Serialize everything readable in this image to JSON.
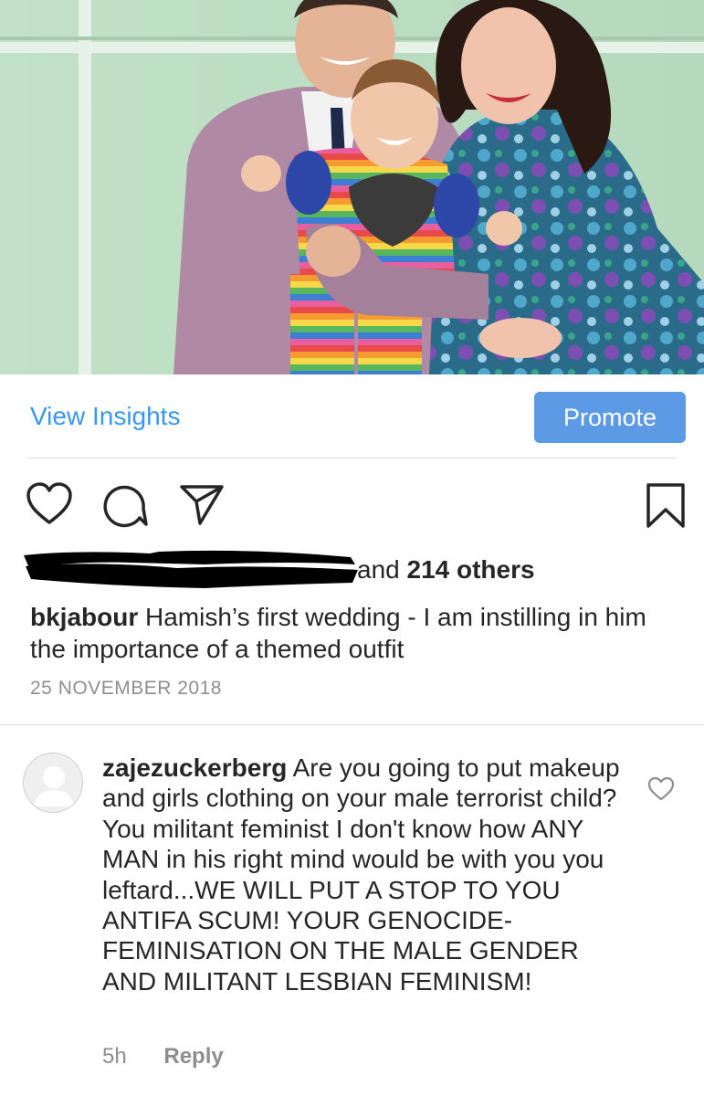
{
  "post": {
    "photo_alt": "family-photo",
    "view_insights_label": "View Insights",
    "promote_label": "Promote",
    "likes": {
      "others_prefix": "and",
      "others_count": "214 others"
    },
    "caption": {
      "username": "bkjabour",
      "text": "Hamish’s first wedding - I am instilling in him the importance of a themed outfit"
    },
    "date": "25 NOVEMBER 2018"
  },
  "comment": {
    "username": "zajezuckerberg",
    "text": "Are you going to put makeup and girls clothing on your male terrorist child? You militant feminist I don't know how ANY MAN in his right mind would be with you you leftard...WE WILL PUT A STOP TO YOU ANTIFA SCUM! YOUR GENOCIDE-FEMINISATION ON THE MALE GENDER AND MILITANT LESBIAN FEMINISM!",
    "time": "5h",
    "reply_label": "Reply"
  },
  "icons": {
    "like": "heart-icon",
    "comment": "comment-icon",
    "share": "paper-plane-icon",
    "save": "bookmark-icon",
    "comment_like": "heart-icon",
    "avatar": "default-avatar-icon"
  },
  "colors": {
    "link_blue": "#3897f0",
    "promote_bg": "#5c9ae6",
    "text": "#262626",
    "muted": "#8e8e8e",
    "divider": "#dbdbdb",
    "wall_green": "#bfe0c6"
  }
}
